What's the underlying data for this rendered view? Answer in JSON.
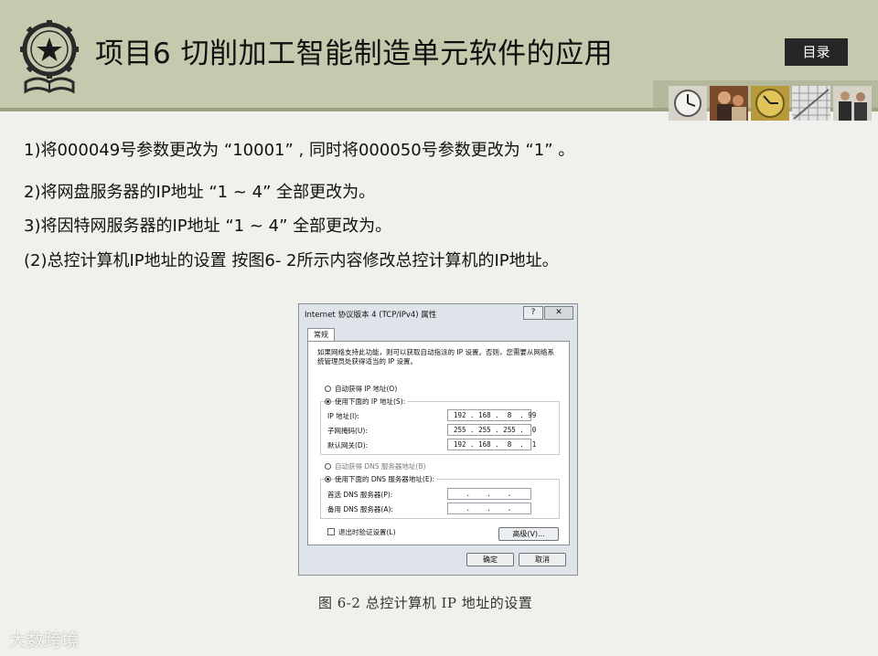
{
  "header": {
    "title": "项目6  切削加工智能制造单元软件的应用",
    "toc_label": "目录",
    "colors": {
      "band": "#c5c9ad",
      "toc_bg": "#262626"
    },
    "logo_icon": "star-book-gear-emblem-icon"
  },
  "body": {
    "lines": [
      "1)将000049号参数更改为 “10001” , 同时将000050号参数更改为 “1” 。",
      "2)将网盘服务器的IP地址 “1 ~ 4” 全部更改为。",
      "3)将因特网服务器的IP地址 “1 ~ 4” 全部更改为。",
      "(2)总控计算机IP地址的设置     按图6-  2所示内容修改总控计算机的IP地址。"
    ]
  },
  "dialog": {
    "title": "Internet 协议版本 4 (TCP/IPv4) 属性",
    "help": "?",
    "close": "✕",
    "tab": "常规",
    "description": "如果网络支持此功能，则可以获取自动指派的 IP 设置。否则，您需要从网络系统管理员处获得适当的 IP 设置。",
    "auto_ip": "自动获得 IP 地址(O)",
    "manual_ip": "使用下面的 IP 地址(S):",
    "ip_label": "IP 地址(I):",
    "ip_value": "192 . 168 .  8  . 99",
    "mask_label": "子网掩码(U):",
    "mask_value": "255 . 255 . 255 .  0",
    "gateway_label": "默认网关(D):",
    "gateway_value": "192 . 168 .  8  .  1",
    "auto_dns": "自动获得 DNS 服务器地址(B)",
    "manual_dns": "使用下面的 DNS 服务器地址(E):",
    "dns1_label": "首选 DNS 服务器(P):",
    "dns1_value": "   .    .    .   ",
    "dns2_label": "备用 DNS 服务器(A):",
    "dns2_value": "   .    .    .   ",
    "validate": "退出时验证设置(L)",
    "advanced": "高级(V)...",
    "ok": "确定",
    "cancel": "取消"
  },
  "caption": "图 6-2    总控计算机 IP 地址的设置",
  "watermark": "大数跨境"
}
